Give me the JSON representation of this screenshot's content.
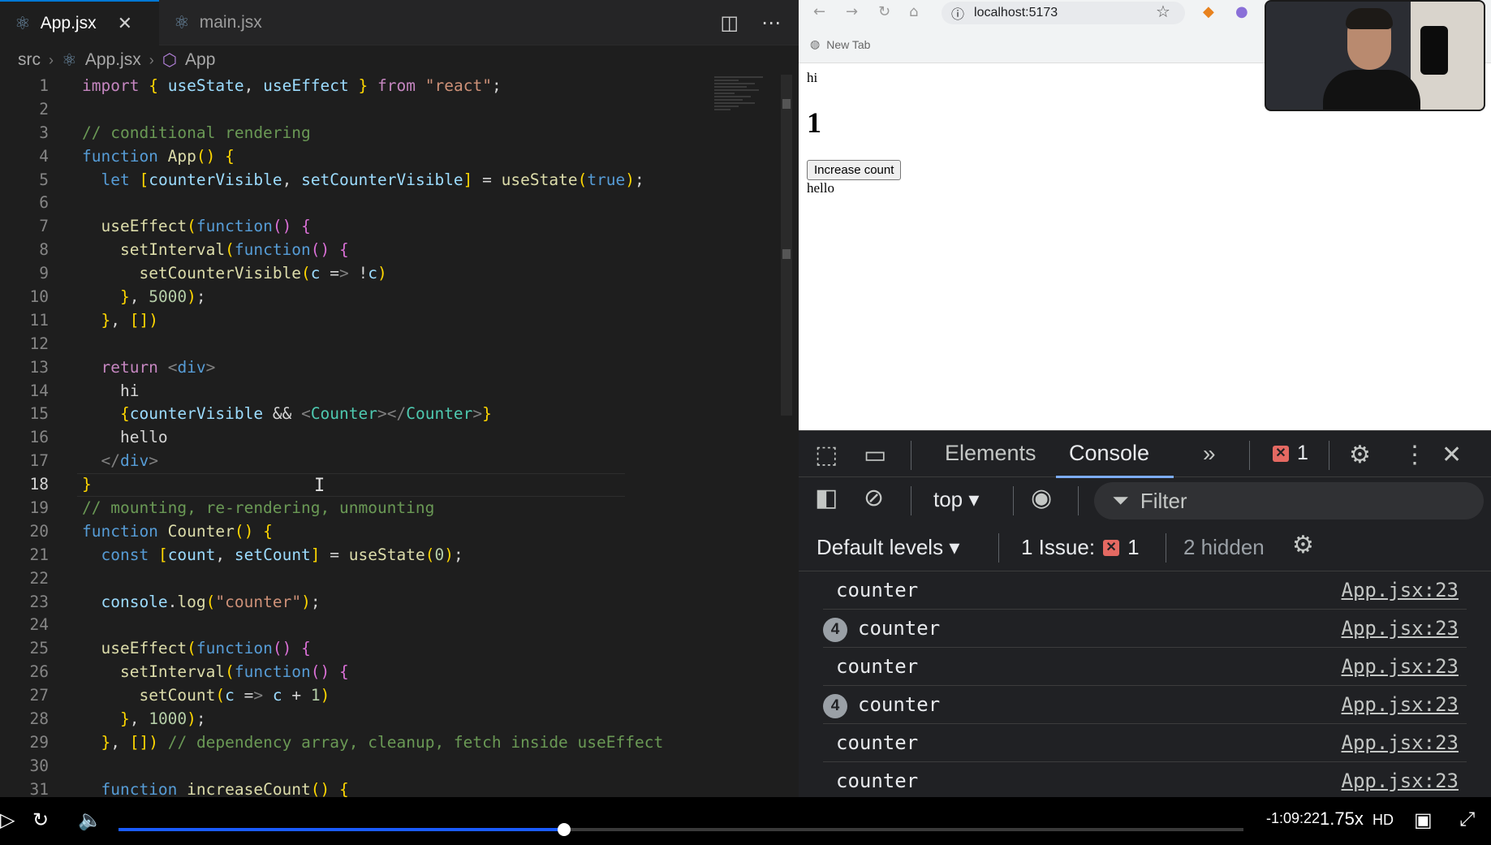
{
  "editor": {
    "tabs": [
      {
        "label": "App.jsx",
        "active": true
      },
      {
        "label": "main.jsx",
        "active": false
      }
    ],
    "breadcrumb": [
      "src",
      "App.jsx",
      "App"
    ],
    "current_line": 18,
    "line_numbers": [
      "1",
      "2",
      "3",
      "4",
      "5",
      "6",
      "7",
      "8",
      "9",
      "10",
      "11",
      "12",
      "13",
      "14",
      "15",
      "16",
      "17",
      "18",
      "19",
      "20",
      "21",
      "22",
      "23",
      "24",
      "25",
      "26",
      "27",
      "28",
      "29",
      "30",
      "31"
    ],
    "code_lines": [
      "import { useState, useEffect } from \"react\";",
      "",
      "// conditional rendering",
      "function App() {",
      "  let [counterVisible, setCounterVisible] = useState(true);",
      "",
      "  useEffect(function() {",
      "    setInterval(function() {",
      "      setCounterVisible(c => !c)",
      "    }, 5000);",
      "  }, [])",
      "",
      "  return <div>",
      "    hi",
      "    {counterVisible && <Counter></Counter>}",
      "    hello",
      "  </div>",
      "}",
      "// mounting, re-rendering, unmounting",
      "function Counter() {",
      "  const [count, setCount] = useState(0);",
      "",
      "  console.log(\"counter\");",
      "",
      "  useEffect(function() {",
      "    setInterval(function() {",
      "      setCount(c => c + 1)",
      "    }, 1000);",
      "  }, []) // dependency array, cleanup, fetch inside useEffect",
      "",
      "  function increaseCount() {"
    ]
  },
  "browser": {
    "url": "localhost:5173",
    "bookmark_label": "New Tab",
    "page": {
      "hi": "hi",
      "count": "1",
      "button_label": "Increase count",
      "hello": "hello"
    }
  },
  "devtools": {
    "tabs": [
      "Elements",
      "Console"
    ],
    "active_tab": "Console",
    "error_count": "1",
    "context": "top",
    "filter_placeholder": "Filter",
    "levels": "Default levels",
    "issues_label": "1 Issue:",
    "issues_count": "1",
    "hidden_label": "2 hidden",
    "messages": [
      {
        "text": "counter",
        "repeat": "",
        "source": "App.jsx:23"
      },
      {
        "text": "counter",
        "repeat": "4",
        "source": "App.jsx:23"
      },
      {
        "text": "counter",
        "repeat": "",
        "source": "App.jsx:23"
      },
      {
        "text": "counter",
        "repeat": "4",
        "source": "App.jsx:23"
      },
      {
        "text": "counter",
        "repeat": "",
        "source": "App.jsx:23"
      },
      {
        "text": "counter",
        "repeat": "",
        "source": "App.jsx:23"
      }
    ]
  },
  "player": {
    "remaining": "-1:09:22",
    "speed": "1.75x",
    "progress_fraction": 0.396
  },
  "colors": {
    "accent": "#0078d4",
    "progress": "#1a5cff",
    "error": "#e46962"
  }
}
